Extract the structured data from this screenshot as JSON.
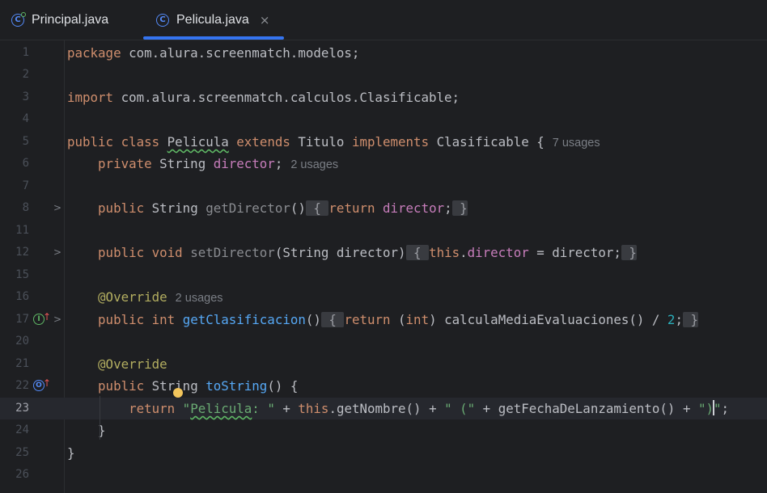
{
  "tabs": [
    {
      "label": "Principal.java",
      "icon": "java-class-icon",
      "active": false
    },
    {
      "label": "Pelicula.java",
      "icon": "java-class-icon",
      "active": true,
      "close": "×"
    }
  ],
  "colors": {
    "background": "#1e1f22",
    "keyword": "#cf8e6d",
    "field": "#c77dbb",
    "method": "#56a8f5",
    "string": "#6aab73",
    "number": "#2aacb8",
    "annotation": "#b3ae60",
    "accent": "#3574f0"
  },
  "gutter": {
    "line_numbers": [
      "1",
      "2",
      "3",
      "4",
      "5",
      "6",
      "7",
      "8",
      "11",
      "12",
      "15",
      "16",
      "17",
      "20",
      "21",
      "22",
      "23",
      "24",
      "25",
      "26"
    ],
    "current_line": "23"
  },
  "code": {
    "l1": {
      "kw": "package",
      "rest": " com.alura.screenmatch.modelos;"
    },
    "l3": {
      "kw": "import",
      "rest": " com.alura.screenmatch.calculos.Clasificable;"
    },
    "l5": {
      "kw1": "public",
      "kw2": "class",
      "name": "Pelicula",
      "kw3": "extends",
      "parent": "Titulo",
      "kw4": "implements",
      "iface": "Clasificable",
      "brace": " {",
      "hint": "7 usages"
    },
    "l6": {
      "kw": "private",
      "type": " String ",
      "field": "director",
      "semi": ";",
      "hint": "2 usages"
    },
    "l8": {
      "kw": "public",
      "type": " String ",
      "method": "getDirector",
      "parens": "()",
      "fb_open": " { ",
      "kw_ret": "return",
      "field": " director",
      "semi": ";",
      "fb_close": " }"
    },
    "l12": {
      "kw": "public",
      "kw2": " void ",
      "method": "setDirector",
      "params": "(String director)",
      "fb_open": " { ",
      "kw_this": "this",
      "dot": ".",
      "field": "director",
      "assign": " = director;",
      "fb_close": " }"
    },
    "l16": {
      "ann": "@Override",
      "hint": "2 usages"
    },
    "l17": {
      "kw": "public",
      "kw2": " int ",
      "method": "getClasificacion",
      "parens": "()",
      "fb_open": " { ",
      "kw_ret": "return",
      "cast_open": " (",
      "kw_int": "int",
      "rest": ") calculaMediaEvaluaciones() / ",
      "num": "2",
      "semi": ";",
      "fb_close": " }"
    },
    "l21": {
      "ann": "@Override"
    },
    "l22": {
      "kw": "public",
      "type": " String ",
      "method": "toString",
      "rest": "() {"
    },
    "l23": {
      "kw_ret": "return",
      "str1_q": " \"",
      "str1_word": "Pelicula",
      "str1_end": ": \"",
      "op1": " + ",
      "kw_this": "this",
      "call1": ".getNombre() + ",
      "str2": "\" (\"",
      "call2": " + getFechaDeLanzamiento() + ",
      "str3_a": "\")",
      "str3_b": "\"",
      "semi": ";"
    },
    "l24": {
      "text": "}"
    },
    "l25": {
      "text": "}"
    }
  }
}
